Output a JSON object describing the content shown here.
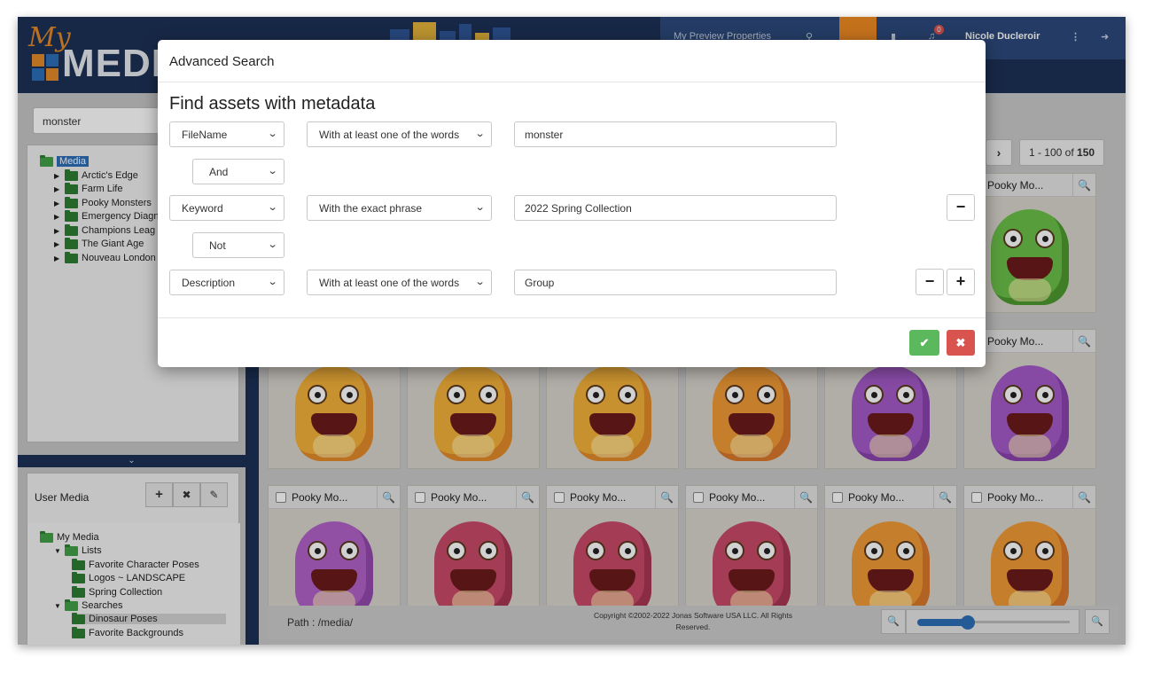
{
  "app": {
    "logo_my": "My",
    "logo_media": "MEDIA"
  },
  "header": {
    "preview_properties": "My Preview Properties",
    "notification_count": "0",
    "user_name": "Nicole Ducleroir"
  },
  "left": {
    "search_value": "monster",
    "tree": [
      {
        "label": "Media",
        "selected": true
      },
      {
        "label": "Arctic's Edge"
      },
      {
        "label": "Farm Life"
      },
      {
        "label": "Pooky Monsters"
      },
      {
        "label": "Emergency Diagn"
      },
      {
        "label": "Champions Leag"
      },
      {
        "label": "The Giant Age"
      },
      {
        "label": "Nouveau London"
      }
    ],
    "collapse_icon": "chevron-down-icon",
    "user_media": {
      "title": "User Media",
      "add_label": "+",
      "remove_label": "✖",
      "edit_label": "✎",
      "tree": [
        {
          "label": "My Media"
        },
        {
          "label": "Lists"
        },
        {
          "label": "Favorite Character Poses"
        },
        {
          "label": "Logos ~ LANDSCAPE"
        },
        {
          "label": "Spring Collection"
        },
        {
          "label": "Searches"
        },
        {
          "label": "Dinosaur Poses"
        },
        {
          "label": "Favorite Backgrounds"
        }
      ]
    }
  },
  "main": {
    "pager_range": "1 - 100",
    "pager_of": "of",
    "pager_total": "150",
    "card_title": "Pooky Mo...",
    "path": "Path : /media/",
    "copyright_line1": "Copyright ©2002-2022 Jonas Software USA LLC. All Rights",
    "copyright_line2": "Reserved.",
    "zoom_level_fraction": 0.33
  },
  "modal": {
    "title": "Advanced Search",
    "section_title": "Find assets with metadata",
    "rows": [
      {
        "field": "FileName",
        "condition": "With at least one of the words",
        "value": "monster"
      },
      {
        "connector": "And"
      },
      {
        "field": "Keyword",
        "condition": "With the exact phrase",
        "value": "2022 Spring Collection"
      },
      {
        "connector": "Not"
      },
      {
        "field": "Description",
        "condition": "With at least one of the words",
        "value": "Group"
      }
    ],
    "minus_label": "−",
    "plus_label": "+",
    "ok_label": "✔",
    "cancel_label": "✖"
  },
  "colors": {
    "header_bg": "#1d3157",
    "accent_blue": "#2d6fb8",
    "ok_green": "#5cb85c",
    "cancel_red": "#d9534f",
    "orange": "#f08a23"
  }
}
